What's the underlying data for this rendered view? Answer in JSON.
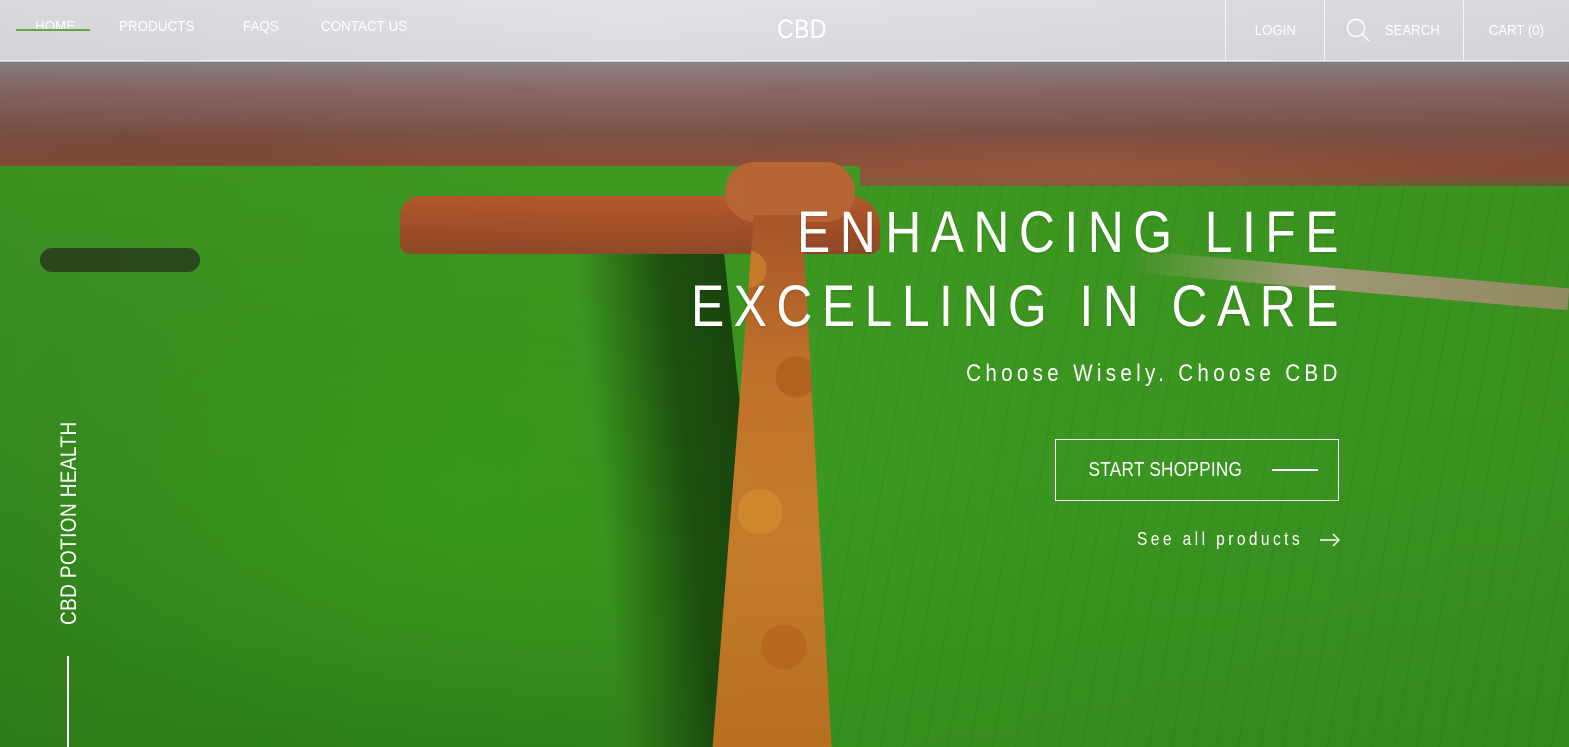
{
  "header": {
    "nav_left": [
      "HOME",
      "PRODUCTS",
      "FAQS",
      "CONTACT US"
    ],
    "brand": "CBD",
    "login": "LOGIN",
    "search": "SEARCH",
    "cart": "CART (0)"
  },
  "hero": {
    "headline_line1": "ENHANCING LIFE",
    "headline_line2": "EXCELLING IN CARE",
    "tagline": "Choose Wisely. Choose CBD",
    "cta_label": "START SHOPPING",
    "secondary_link": "See all products",
    "side_label": "CBD POTION HEALTH"
  },
  "icons": {
    "search": "search-icon",
    "arrow": "arrow-right-icon"
  },
  "colors": {
    "accent": "#5fa83a",
    "text": "#ffffff"
  }
}
